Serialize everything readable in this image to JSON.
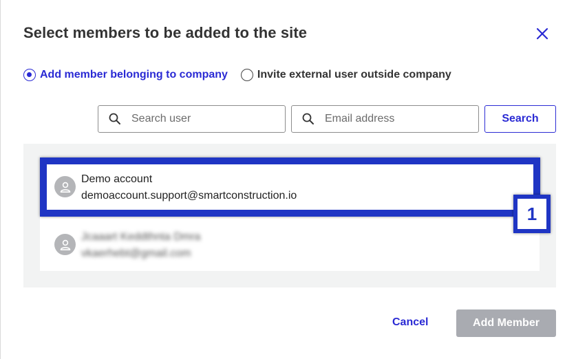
{
  "dialog": {
    "title": "Select members to be added to the site"
  },
  "radio_options": [
    {
      "label": "Add member belonging to company",
      "selected": true
    },
    {
      "label": "Invite external user outside company",
      "selected": false
    }
  ],
  "search": {
    "user_placeholder": "Search user",
    "email_placeholder": "Email address",
    "button_label": "Search"
  },
  "results": [
    {
      "name": "Demo account",
      "email": "demoaccount.support@smartconstruction.io",
      "blurred": false
    },
    {
      "name": "Jcaaart Keddthnta Dmra",
      "email": "vkaerhebt@gmail.com",
      "blurred": true
    }
  ],
  "annotation": {
    "badge_number": "1",
    "color": "#1f35c4"
  },
  "footer": {
    "cancel_label": "Cancel",
    "add_label": "Add Member"
  },
  "colors": {
    "accent": "#2a2ad4",
    "disabled_button": "#a9abb1",
    "results_bg": "#f2f3f3"
  }
}
